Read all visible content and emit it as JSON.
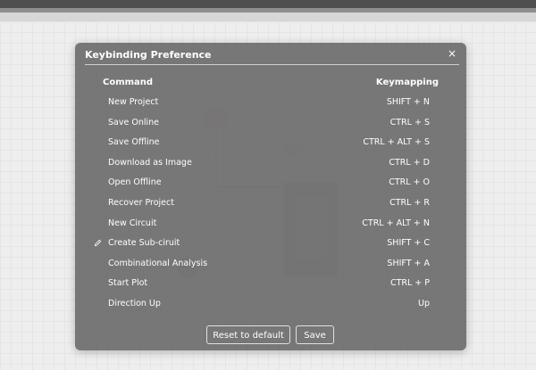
{
  "dialog": {
    "title": "Keybinding Preference",
    "close_glyph": "×",
    "header_command": "Command",
    "header_keymapping": "Keymapping",
    "rows": [
      {
        "command": "New Project",
        "keys": "SHIFT + N",
        "icon": ""
      },
      {
        "command": "Save Online",
        "keys": "CTRL + S",
        "icon": ""
      },
      {
        "command": "Save Offline",
        "keys": "CTRL + ALT + S",
        "icon": ""
      },
      {
        "command": "Download as Image",
        "keys": "CTRL + D",
        "icon": ""
      },
      {
        "command": "Open Offline",
        "keys": "CTRL + O",
        "icon": ""
      },
      {
        "command": "Recover Project",
        "keys": "CTRL + R",
        "icon": ""
      },
      {
        "command": "New Circuit",
        "keys": "CTRL + ALT + N",
        "icon": ""
      },
      {
        "command": "Create Sub-ciruit",
        "keys": "SHIFT + C",
        "icon": "pencil-icon"
      },
      {
        "command": "Combinational Analysis",
        "keys": "SHIFT + A",
        "icon": ""
      },
      {
        "command": "Start Plot",
        "keys": "CTRL + P",
        "icon": ""
      },
      {
        "command": "Direction Up",
        "keys": "Up",
        "icon": ""
      }
    ],
    "reset_label": "Reset to default",
    "save_label": "Save"
  },
  "colors": {
    "dialog_bg": "#6e6e6e",
    "text": "#ffffff",
    "topbar": "#4f4f4f"
  }
}
